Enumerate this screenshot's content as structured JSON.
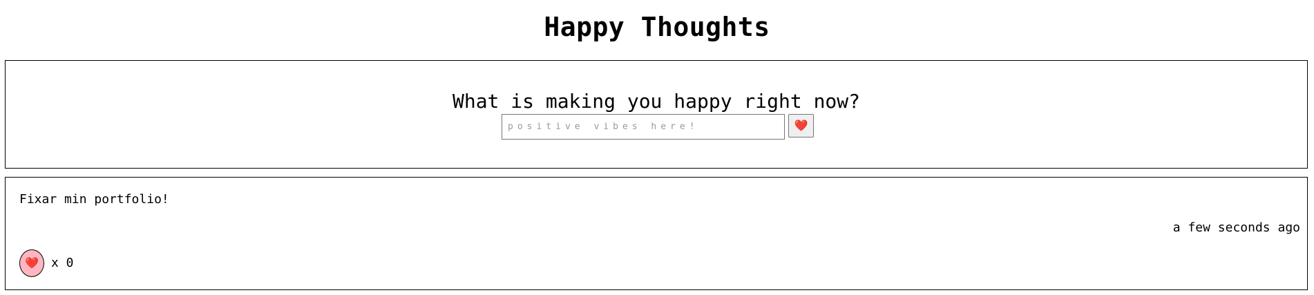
{
  "header": {
    "title": "Happy Thoughts"
  },
  "form": {
    "question": "What is making you happy right now?",
    "input_placeholder": "positive vibes here!",
    "input_value": "",
    "submit_icon": "heart-icon"
  },
  "thoughts": [
    {
      "message": "Fixar min portfolio!",
      "time": "a few seconds ago",
      "like_icon": "heart-icon",
      "likes_text": "x 0"
    }
  ],
  "colors": {
    "heart": "#e0142b",
    "like_button_bg": "#ffb6c1",
    "border": "#000000"
  }
}
